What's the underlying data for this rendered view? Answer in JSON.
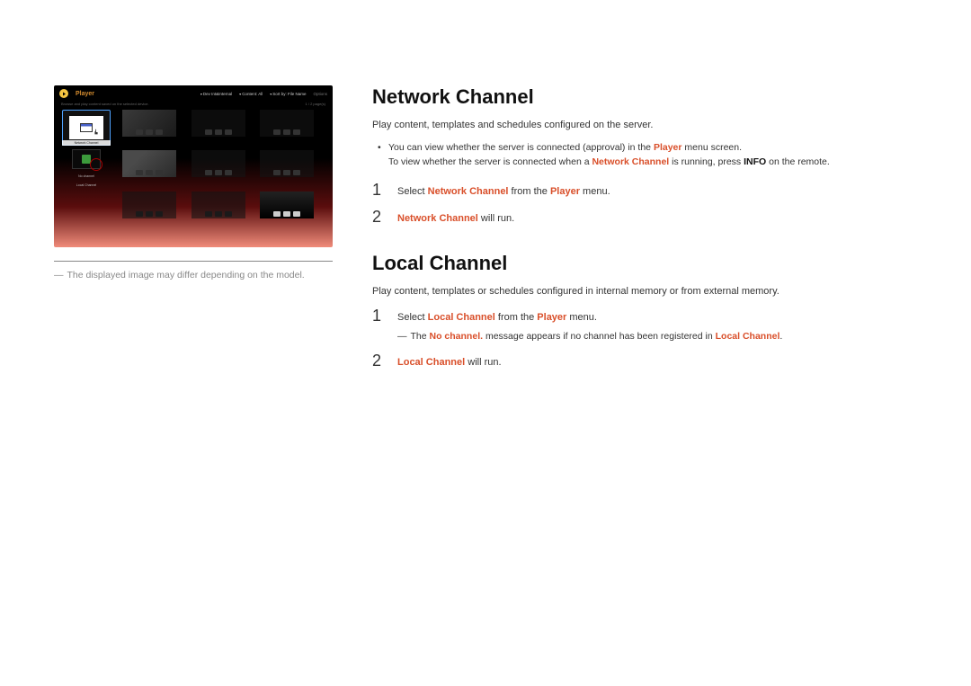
{
  "screenshot": {
    "header": {
      "title": "Player",
      "filter_device_label": "Dev Int&Internal",
      "filter_content_label": "Content: All",
      "sort_label": "Sort by: File Name",
      "options_label": "Options"
    },
    "subheader": {
      "desc": "Browse and play content saved on the selected device.",
      "pager": "1 / 2 page(s)"
    },
    "sidebar": {
      "network_card_label": "Network Channel",
      "item2_label": "No channel",
      "item3_label": "Local Channel"
    }
  },
  "caption": {
    "dash": "―",
    "text": "The displayed image may differ depending on the model."
  },
  "section1": {
    "heading": "Network Channel",
    "desc": "Play content, templates and schedules configured on the server.",
    "bullet_line1_a": "You can view whether the server is connected (approval) in the ",
    "bullet_line1_b": "Player",
    "bullet_line1_c": " menu screen.",
    "bullet_line2_a": "To view whether the server is connected when a ",
    "bullet_line2_b": "Network Channel",
    "bullet_line2_c": " is running, press ",
    "bullet_line2_d": "INFO",
    "bullet_line2_e": " on the remote.",
    "step1": {
      "num": "1",
      "a": "Select ",
      "b": "Network Channel",
      "c": " from the ",
      "d": "Player",
      "e": " menu."
    },
    "step2": {
      "num": "2",
      "a": "Network Channel",
      "b": " will run."
    }
  },
  "section2": {
    "heading": "Local Channel",
    "desc": "Play content, templates or schedules configured in internal memory or from external memory.",
    "step1": {
      "num": "1",
      "a": "Select ",
      "b": "Local Channel",
      "c": " from the ",
      "d": "Player",
      "e": " menu."
    },
    "note": {
      "dash": "―",
      "a": "The ",
      "b": "No channel.",
      "c": " message appears if no channel has been registered in ",
      "d": "Local Channel",
      "e": "."
    },
    "step2": {
      "num": "2",
      "a": "Local Channel",
      "b": " will run."
    }
  }
}
